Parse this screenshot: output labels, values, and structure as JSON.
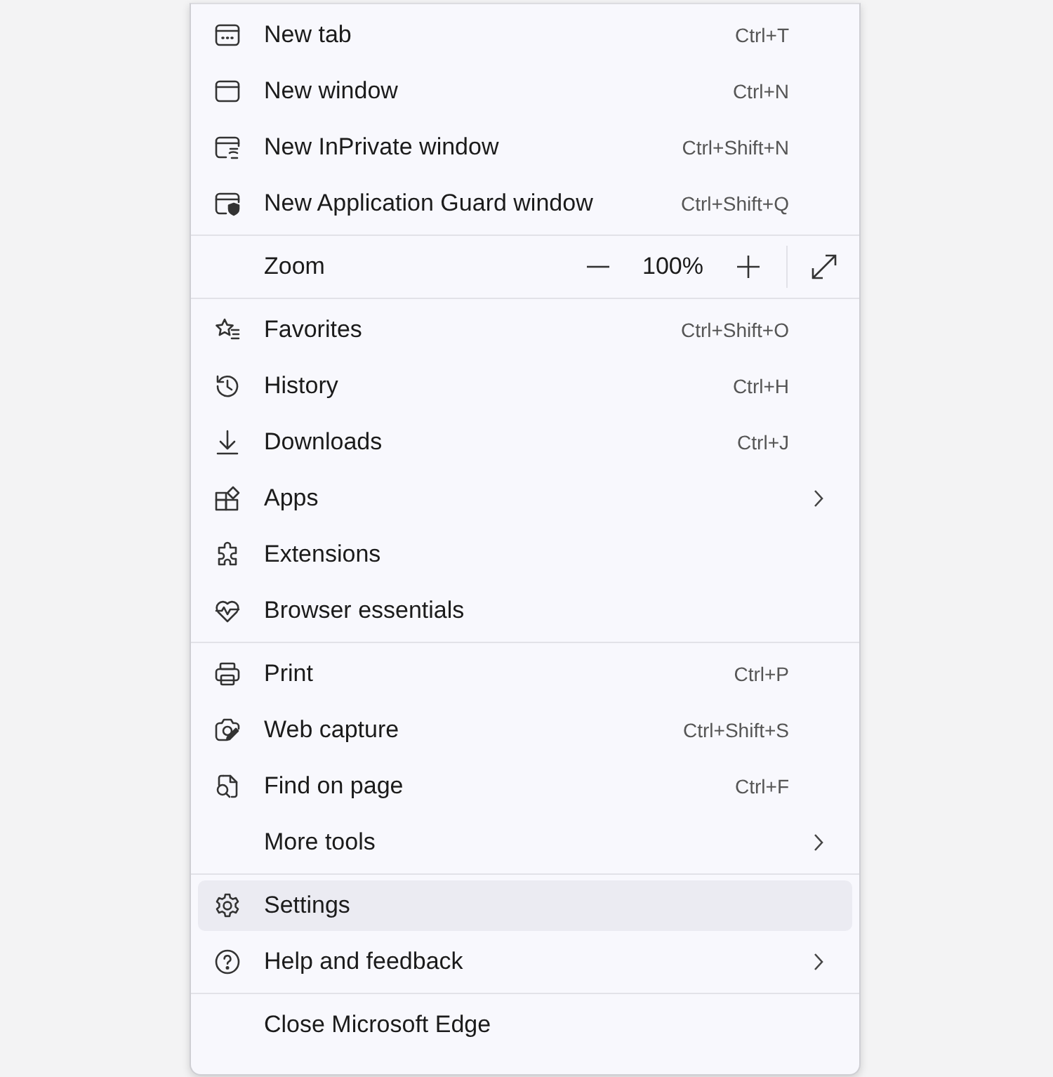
{
  "menu": {
    "sections": [
      {
        "items": [
          {
            "kind": "command",
            "label": "New tab",
            "shortcut": "Ctrl+T",
            "submenu": false,
            "selected": false
          },
          {
            "kind": "command",
            "label": "New window",
            "shortcut": "Ctrl+N",
            "submenu": false,
            "selected": false
          },
          {
            "kind": "command",
            "label": "New InPrivate window",
            "shortcut": "Ctrl+Shift+N",
            "submenu": false,
            "selected": false
          },
          {
            "kind": "command",
            "label": "New Application Guard window",
            "shortcut": "Ctrl+Shift+Q",
            "submenu": false,
            "selected": false
          }
        ]
      },
      {
        "items": [
          {
            "kind": "zoom",
            "label": "Zoom",
            "value": "100%"
          }
        ]
      },
      {
        "items": [
          {
            "kind": "command",
            "label": "Favorites",
            "shortcut": "Ctrl+Shift+O",
            "submenu": false,
            "selected": false
          },
          {
            "kind": "command",
            "label": "History",
            "shortcut": "Ctrl+H",
            "submenu": false,
            "selected": false
          },
          {
            "kind": "command",
            "label": "Downloads",
            "shortcut": "Ctrl+J",
            "submenu": false,
            "selected": false
          },
          {
            "kind": "command",
            "label": "Apps",
            "submenu": true,
            "selected": false
          },
          {
            "kind": "command",
            "label": "Extensions",
            "submenu": false,
            "selected": false
          },
          {
            "kind": "command",
            "label": "Browser essentials",
            "submenu": false,
            "selected": false
          }
        ]
      },
      {
        "items": [
          {
            "kind": "command",
            "label": "Print",
            "shortcut": "Ctrl+P",
            "submenu": false,
            "selected": false
          },
          {
            "kind": "command",
            "label": "Web capture",
            "shortcut": "Ctrl+Shift+S",
            "submenu": false,
            "selected": false
          },
          {
            "kind": "command",
            "label": "Find on page",
            "shortcut": "Ctrl+F",
            "submenu": false,
            "selected": false
          },
          {
            "kind": "command",
            "label": "More tools",
            "submenu": true,
            "selected": false
          }
        ]
      },
      {
        "items": [
          {
            "kind": "command",
            "label": "Settings",
            "submenu": false,
            "selected": true
          },
          {
            "kind": "command",
            "label": "Help and feedback",
            "submenu": true,
            "selected": false
          }
        ]
      },
      {
        "items": [
          {
            "kind": "command",
            "label": "Close Microsoft Edge",
            "submenu": false,
            "selected": false
          }
        ]
      }
    ]
  }
}
